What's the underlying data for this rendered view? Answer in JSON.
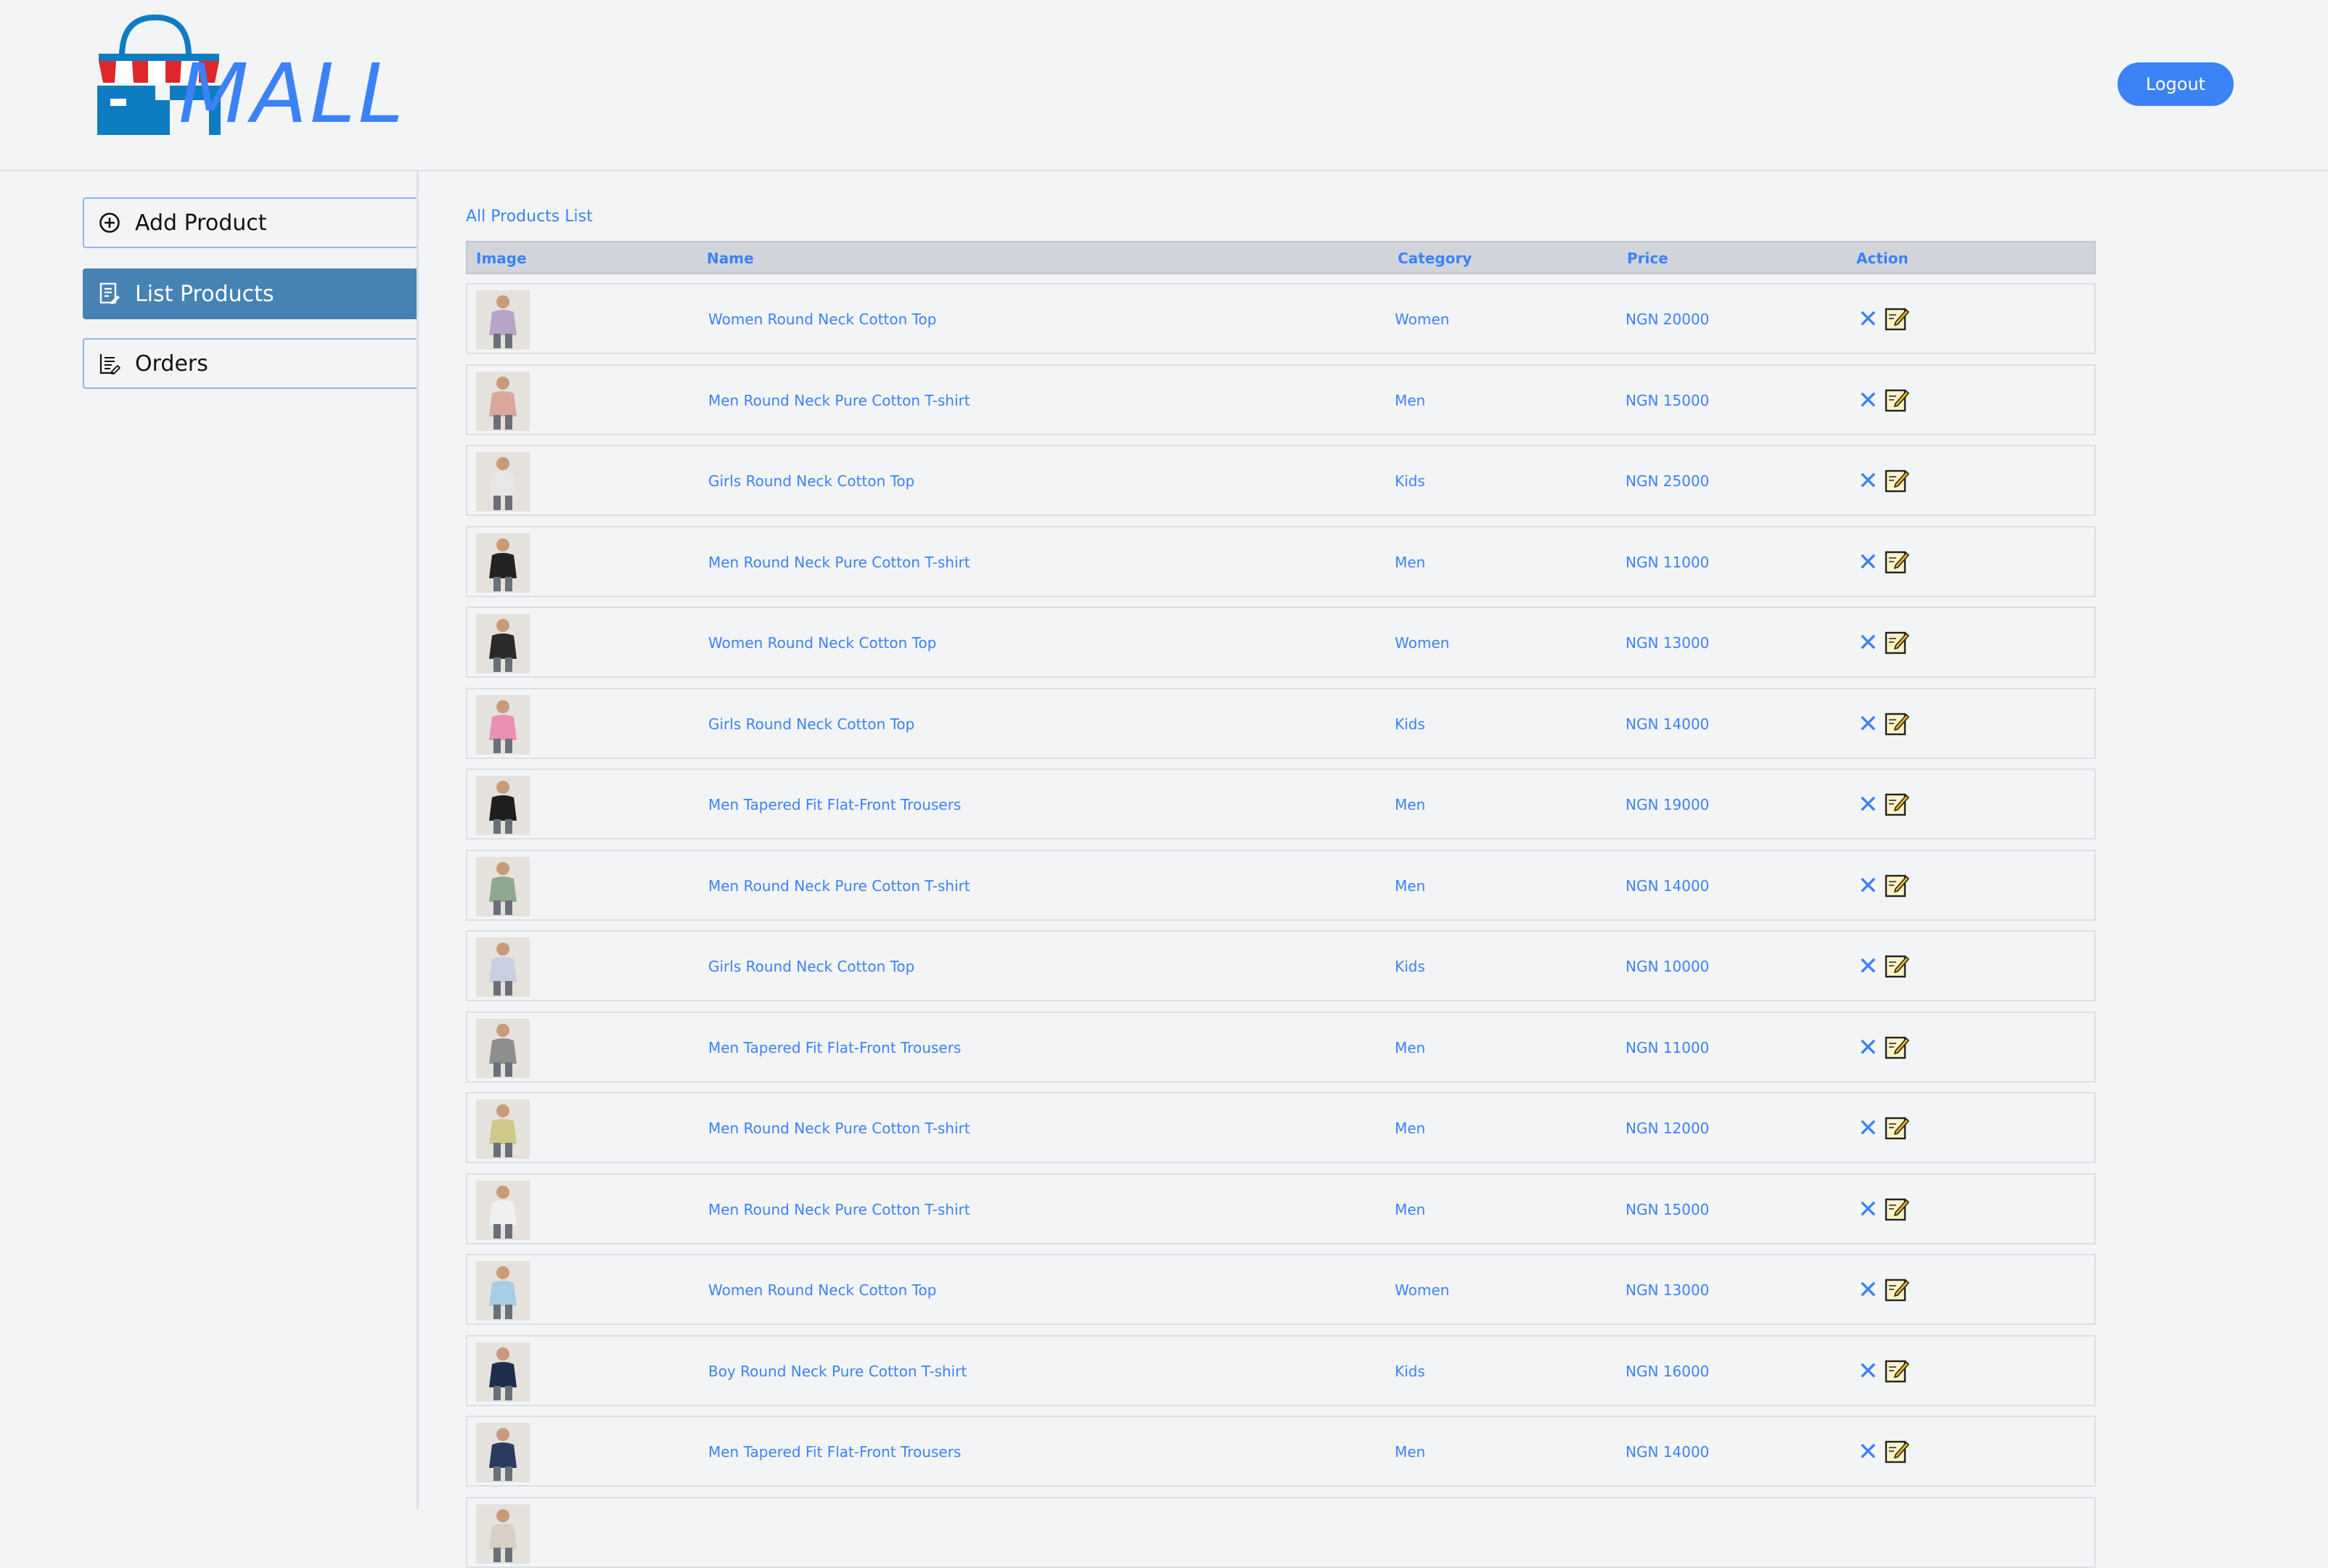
{
  "header": {
    "logo_text": "MALL",
    "logout_label": "Logout"
  },
  "sidebar": {
    "items": [
      {
        "label": "Add Product",
        "icon": "plus-circle-icon",
        "active": false
      },
      {
        "label": "List Products",
        "icon": "list-icon",
        "active": true
      },
      {
        "label": "Orders",
        "icon": "orders-icon",
        "active": false
      }
    ]
  },
  "main": {
    "title": "All Products List",
    "columns": {
      "image": "Image",
      "name": "Name",
      "category": "Category",
      "price": "Price",
      "action": "Action"
    },
    "rows": [
      {
        "name": "Women Round Neck Cotton Top",
        "category": "Women",
        "price": "NGN 20000",
        "thumb": "#b7a4c8"
      },
      {
        "name": "Men Round Neck Pure Cotton T-shirt",
        "category": "Men",
        "price": "NGN 15000",
        "thumb": "#d9a79c"
      },
      {
        "name": "Girls Round Neck Cotton Top",
        "category": "Kids",
        "price": "NGN 25000",
        "thumb": "#e8e6e6"
      },
      {
        "name": "Men Round Neck Pure Cotton T-shirt",
        "category": "Men",
        "price": "NGN 11000",
        "thumb": "#222222"
      },
      {
        "name": "Women Round Neck Cotton Top",
        "category": "Women",
        "price": "NGN 13000",
        "thumb": "#2a2a2a"
      },
      {
        "name": "Girls Round Neck Cotton Top",
        "category": "Kids",
        "price": "NGN 14000",
        "thumb": "#ec8fb5"
      },
      {
        "name": "Men Tapered Fit Flat-Front Trousers",
        "category": "Men",
        "price": "NGN 19000",
        "thumb": "#1e1e1e"
      },
      {
        "name": "Men Round Neck Pure Cotton T-shirt",
        "category": "Men",
        "price": "NGN 14000",
        "thumb": "#8fa88f"
      },
      {
        "name": "Girls Round Neck Cotton Top",
        "category": "Kids",
        "price": "NGN 10000",
        "thumb": "#c9cfe3"
      },
      {
        "name": "Men Tapered Fit Flat-Front Trousers",
        "category": "Men",
        "price": "NGN 11000",
        "thumb": "#8e8e8e"
      },
      {
        "name": "Men Round Neck Pure Cotton T-shirt",
        "category": "Men",
        "price": "NGN 12000",
        "thumb": "#cfc98c"
      },
      {
        "name": "Men Round Neck Pure Cotton T-shirt",
        "category": "Men",
        "price": "NGN 15000",
        "thumb": "#f0f0f0"
      },
      {
        "name": "Women Round Neck Cotton Top",
        "category": "Women",
        "price": "NGN 13000",
        "thumb": "#a9cde4"
      },
      {
        "name": "Boy Round Neck Pure Cotton T-shirt",
        "category": "Kids",
        "price": "NGN 16000",
        "thumb": "#1f2e4d"
      },
      {
        "name": "Men Tapered Fit Flat-Front Trousers",
        "category": "Men",
        "price": "NGN 14000",
        "thumb": "#2b3a5e"
      },
      {
        "name": "",
        "category": "",
        "price": "",
        "thumb": "#d8cfc6"
      }
    ]
  },
  "colors": {
    "accent": "#3b82f6",
    "active_nav": "#4682b4",
    "background": "#f3f4f6"
  }
}
